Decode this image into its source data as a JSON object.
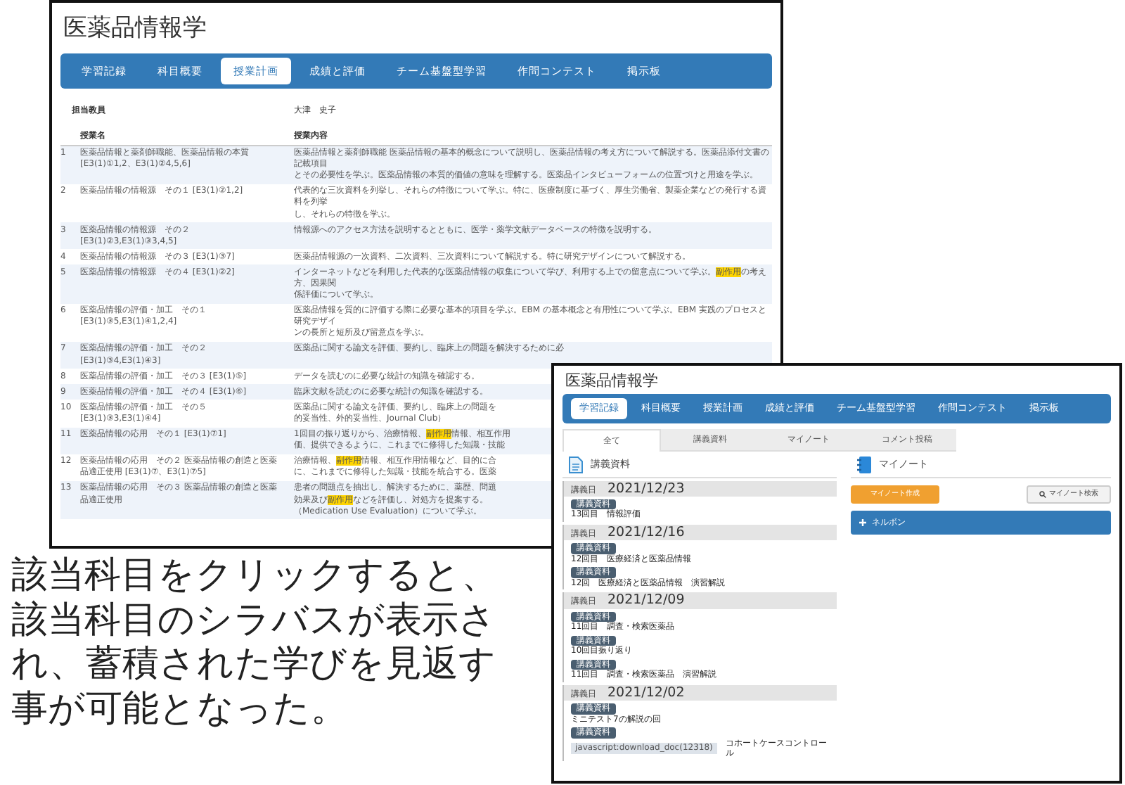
{
  "syllabus_window": {
    "title": "医薬品情報学",
    "tabs": [
      {
        "label": "学習記録",
        "selected": false
      },
      {
        "label": "科目概要",
        "selected": false
      },
      {
        "label": "授業計画",
        "selected": true
      },
      {
        "label": "成績と評価",
        "selected": false
      },
      {
        "label": "チーム基盤型学習",
        "selected": false
      },
      {
        "label": "作問コンテスト",
        "selected": false
      },
      {
        "label": "掲示板",
        "selected": false
      }
    ],
    "instructor_label": "担当教員",
    "instructor": "大津　史子",
    "columns": [
      "授業名",
      "授業内容"
    ],
    "rows": [
      {
        "number": "1",
        "name": [
          "医薬品情報と薬剤師職能、医薬品情報の本質",
          "[E3(1)①1,2、E3(1)②4,5,6]"
        ],
        "content": [
          "医薬品情報と薬剤師職能 医薬品情報の基本的概念について説明し、医薬品情報の考え方について解説する。医薬品添付文書の記載項目",
          "とその必要性を学ぶ。医薬品情報の本質的価値の意味を理解する。医薬品インタビューフォームの位置づけと用途を学ぶ。"
        ]
      },
      {
        "number": "2",
        "name": [
          "医薬品情報の情報源　その１ [E3(1)②1,2]"
        ],
        "content": [
          "代表的な三次資料を列挙し、それらの特徴について学ぶ。特に、医療制度に基づく、厚生労働省、製薬企業などの発行する資料を列挙",
          "し、それらの特徴を学ぶ。"
        ]
      },
      {
        "number": "3",
        "name": [
          "医薬品情報の情報源　その２",
          "[E3(1)②3,E3(1)③3,4,5]"
        ],
        "content": [
          "情報源へのアクセス方法を説明するとともに、医学・薬学文献データベースの特徴を説明する。"
        ]
      },
      {
        "number": "4",
        "name": [
          "医薬品情報の情報源　その３ [E3(1)③7]"
        ],
        "content": [
          "医薬品情報源の一次資料、二次資料、三次資料について解説する。特に研究デザインについて解説する。"
        ]
      },
      {
        "number": "5",
        "name": [
          "医薬品情報の情報源　その４ [E3(1)②2]"
        ],
        "content": [
          "インターネットなどを利用した代表的な医薬品情報の収集について学び、利用する上での留意点について学ぶ。**副作用**の考え方、因果関",
          "係評価について学ぶ。"
        ]
      },
      {
        "number": "6",
        "name": [
          "医薬品情報の評価・加工　その１",
          "[E3(1)③5,E3(1)④1,2,4]"
        ],
        "content": [
          "医薬品情報を質的に評価する際に必要な基本的項目を学ぶ。EBM の基本概念と有用性について学ぶ。EBM 実践のプロセスと研究デザイ",
          "ンの長所と短所及び留意点を学ぶ。"
        ]
      },
      {
        "number": "7",
        "name": [
          "医薬品情報の評価・加工　その２",
          "[E3(1)③4,E3(1)④3]"
        ],
        "content": [
          "医薬品に関する論文を評価、要約し、臨床上の問題を解決するために必"
        ]
      },
      {
        "number": "8",
        "name": [
          "医薬品情報の評価・加工　その３ [E3(1)⑤]"
        ],
        "content": [
          "データを読むのに必要な統計の知識を確認する。"
        ]
      },
      {
        "number": "9",
        "name": [
          "医薬品情報の評価・加工　その４ [E3(1)⑥]"
        ],
        "content": [
          "臨床文献を読むのに必要な統計の知識を確認する。"
        ]
      },
      {
        "number": "10",
        "name": [
          "医薬品情報の評価・加工　その５",
          "[E3(1)③3,E3(1)④4]"
        ],
        "content": [
          "医薬品に関する論文を評価、要約し、臨床上の問題を",
          "的妥当性、外的妥当性、Journal Club）"
        ]
      },
      {
        "number": "11",
        "name": [
          "医薬品情報の応用　その１ [E3(1)⑦1]"
        ],
        "content": [
          "1回目の振り返りから、治療情報、**副作用**情報、相互作用",
          "価、提供できるように、これまでに修得した知識・技能"
        ]
      },
      {
        "number": "12",
        "name": [
          "医薬品情報の応用　その２ 医薬品情報の創造と医薬",
          "品適正使用 [E3(1)⑦、E3(1)⑦5]"
        ],
        "content": [
          "治療情報、**副作用**情報、相互作用情報など、目的に合",
          "に、これまでに修得した知識・技能を統合する。医薬"
        ]
      },
      {
        "number": "13",
        "name": [
          "医薬品情報の応用　その３ 医薬品情報の創造と医薬",
          "品適正使用"
        ],
        "content": [
          "患者の問題点を抽出し、解決するために、薬歴、問題",
          "効果及び**副作用**などを評価し、対処方を提案する。",
          "（Medication Use Evaluation）について学ぶ。"
        ]
      }
    ]
  },
  "caption": "該当科目をクリックすると、該当科目のシラバスが表示され、蓄積された学びを見返す事が可能となった。",
  "records_window": {
    "title": "医薬品情報学",
    "tabs": [
      {
        "label": "学習記録",
        "selected": true
      },
      {
        "label": "科目概要",
        "selected": false
      },
      {
        "label": "授業計画",
        "selected": false
      },
      {
        "label": "成績と評価",
        "selected": false
      },
      {
        "label": "チーム基盤型学習",
        "selected": false
      },
      {
        "label": "作問コンテスト",
        "selected": false
      },
      {
        "label": "掲示板",
        "selected": false
      }
    ],
    "filter_tabs": [
      {
        "label": "全て",
        "selected": true
      },
      {
        "label": "講義資料",
        "selected": false
      },
      {
        "label": "マイノート",
        "selected": false
      },
      {
        "label": "コメント投稿",
        "selected": false
      }
    ],
    "materials_heading": "講義資料",
    "lectures": [
      {
        "date_label": "講義日",
        "date": "2021/12/23",
        "items": [
          {
            "badge": "講義資料",
            "title": "13回目　情報評価"
          }
        ]
      },
      {
        "date_label": "講義日",
        "date": "2021/12/16",
        "items": [
          {
            "badge": "講義資料",
            "title": "12回目　医療経済と医薬品情報"
          },
          {
            "badge": "講義資料",
            "title": "12回　医療経済と医薬品情報　演習解説"
          }
        ]
      },
      {
        "date_label": "講義日",
        "date": "2021/12/09",
        "items": [
          {
            "badge": "講義資料",
            "title": "11回目　調査・検索医薬品"
          },
          {
            "badge": "講義資料",
            "title": "10回目振り返り"
          },
          {
            "badge": "講義資料",
            "title": "11回目　調査・検索医薬品　演習解説"
          }
        ]
      },
      {
        "date_label": "講義日",
        "date": "2021/12/02",
        "items": [
          {
            "badge": "講義資料",
            "title": "ミニテスト7の解説の回"
          },
          {
            "badge": "講義資料",
            "title": "コホートケースコントロール"
          }
        ]
      }
    ],
    "notes_heading": "マイノート",
    "create_note": "マイノート作成",
    "search_note": "マイノート検索",
    "note_folder": "ネルボン",
    "status_bar": "javascript:download_doc(12318)"
  }
}
